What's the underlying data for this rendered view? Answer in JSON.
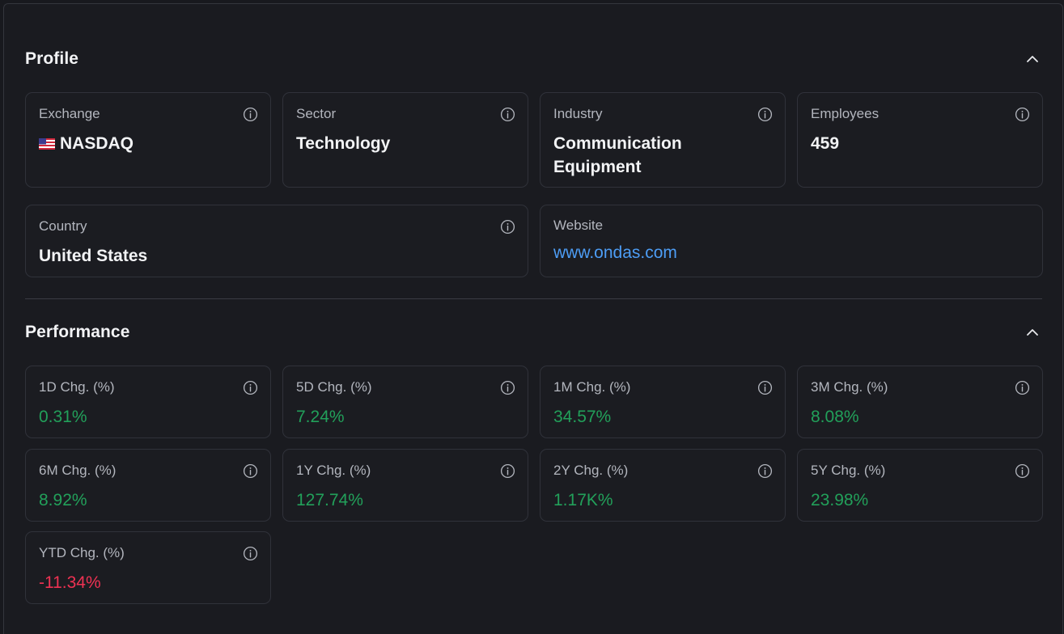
{
  "profile": {
    "title": "Profile",
    "exchange": {
      "label": "Exchange",
      "value": "NASDAQ"
    },
    "sector": {
      "label": "Sector",
      "value": "Technology"
    },
    "industry": {
      "label": "Industry",
      "value_line1": "Communication",
      "value_line2": "Equipment"
    },
    "employees": {
      "label": "Employees",
      "value": "459"
    },
    "country": {
      "label": "Country",
      "value": "United States"
    },
    "website": {
      "label": "Website",
      "value": "www.ondas.com"
    }
  },
  "performance": {
    "title": "Performance",
    "items": [
      {
        "label": "1D Chg. (%)",
        "value": "0.31%"
      },
      {
        "label": "5D Chg. (%)",
        "value": "7.24%"
      },
      {
        "label": "1M Chg. (%)",
        "value": "34.57%"
      },
      {
        "label": "3M Chg. (%)",
        "value": "8.08%"
      },
      {
        "label": "6M Chg. (%)",
        "value": "8.92%"
      },
      {
        "label": "1Y Chg. (%)",
        "value": "127.74%"
      },
      {
        "label": "2Y Chg. (%)",
        "value": "1.17K%"
      },
      {
        "label": "5Y Chg. (%)",
        "value": "23.98%"
      },
      {
        "label": "YTD Chg. (%)",
        "value": "-11.34%"
      }
    ]
  },
  "colors": {
    "background": "#1a1b20",
    "positive": "#22a05a",
    "negative": "#ef3253",
    "link": "#4d9df5"
  },
  "icons": {
    "info": "info-circle-icon",
    "collapse": "chevron-up-icon",
    "flag": "us-flag-icon"
  }
}
